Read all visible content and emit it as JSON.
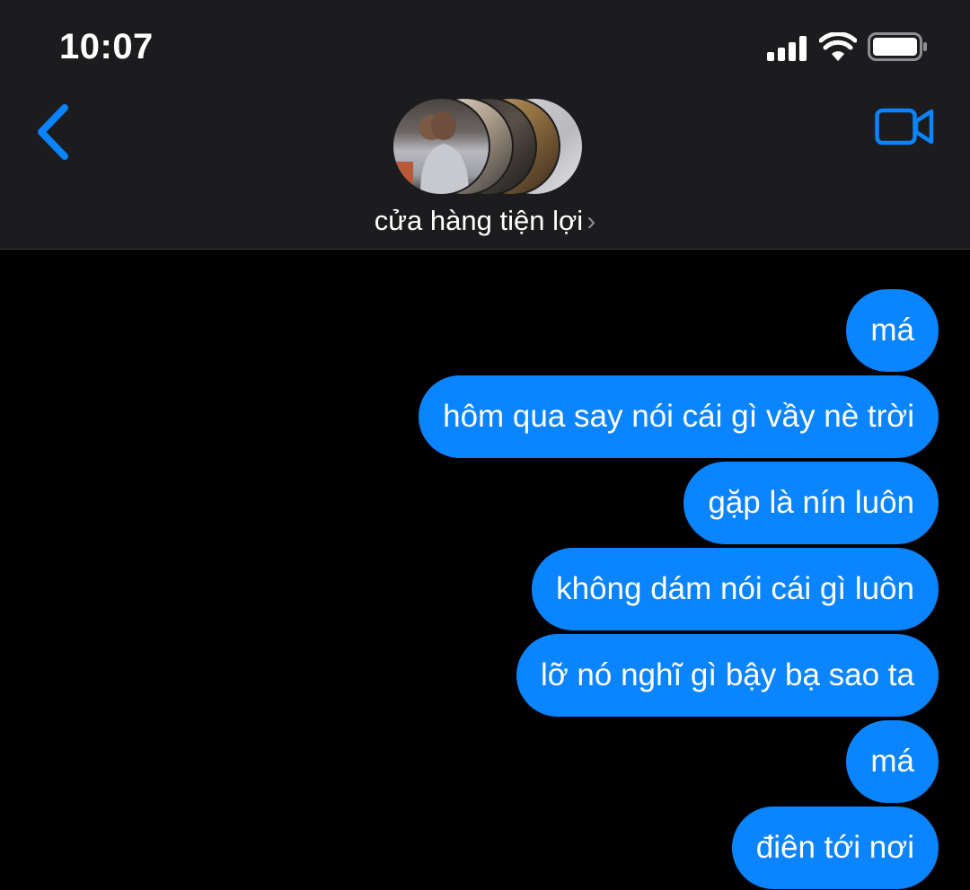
{
  "status_bar": {
    "time": "10:07"
  },
  "header": {
    "back_icon": "chevron-left-icon",
    "video_icon": "video-camera-icon",
    "conversation_name": "cửa hàng tiện lợi",
    "name_chevron": "›",
    "accent_color": "#0a84ff"
  },
  "messages": [
    {
      "text": "má",
      "sender": "me"
    },
    {
      "text": "hôm qua say nói cái gì vầy nè trời",
      "sender": "me"
    },
    {
      "text": "gặp là nín luôn",
      "sender": "me"
    },
    {
      "text": "không dám nói cái gì luôn",
      "sender": "me"
    },
    {
      "text": "lỡ nó nghĩ gì bậy bạ sao ta",
      "sender": "me"
    },
    {
      "text": "má",
      "sender": "me"
    },
    {
      "text": "điên tới nơi",
      "sender": "me"
    }
  ],
  "colors": {
    "header_bg": "#1c1c1e",
    "chat_bg": "#000000",
    "bubble_bg": "#0a84ff",
    "bubble_text": "#ffffff"
  }
}
